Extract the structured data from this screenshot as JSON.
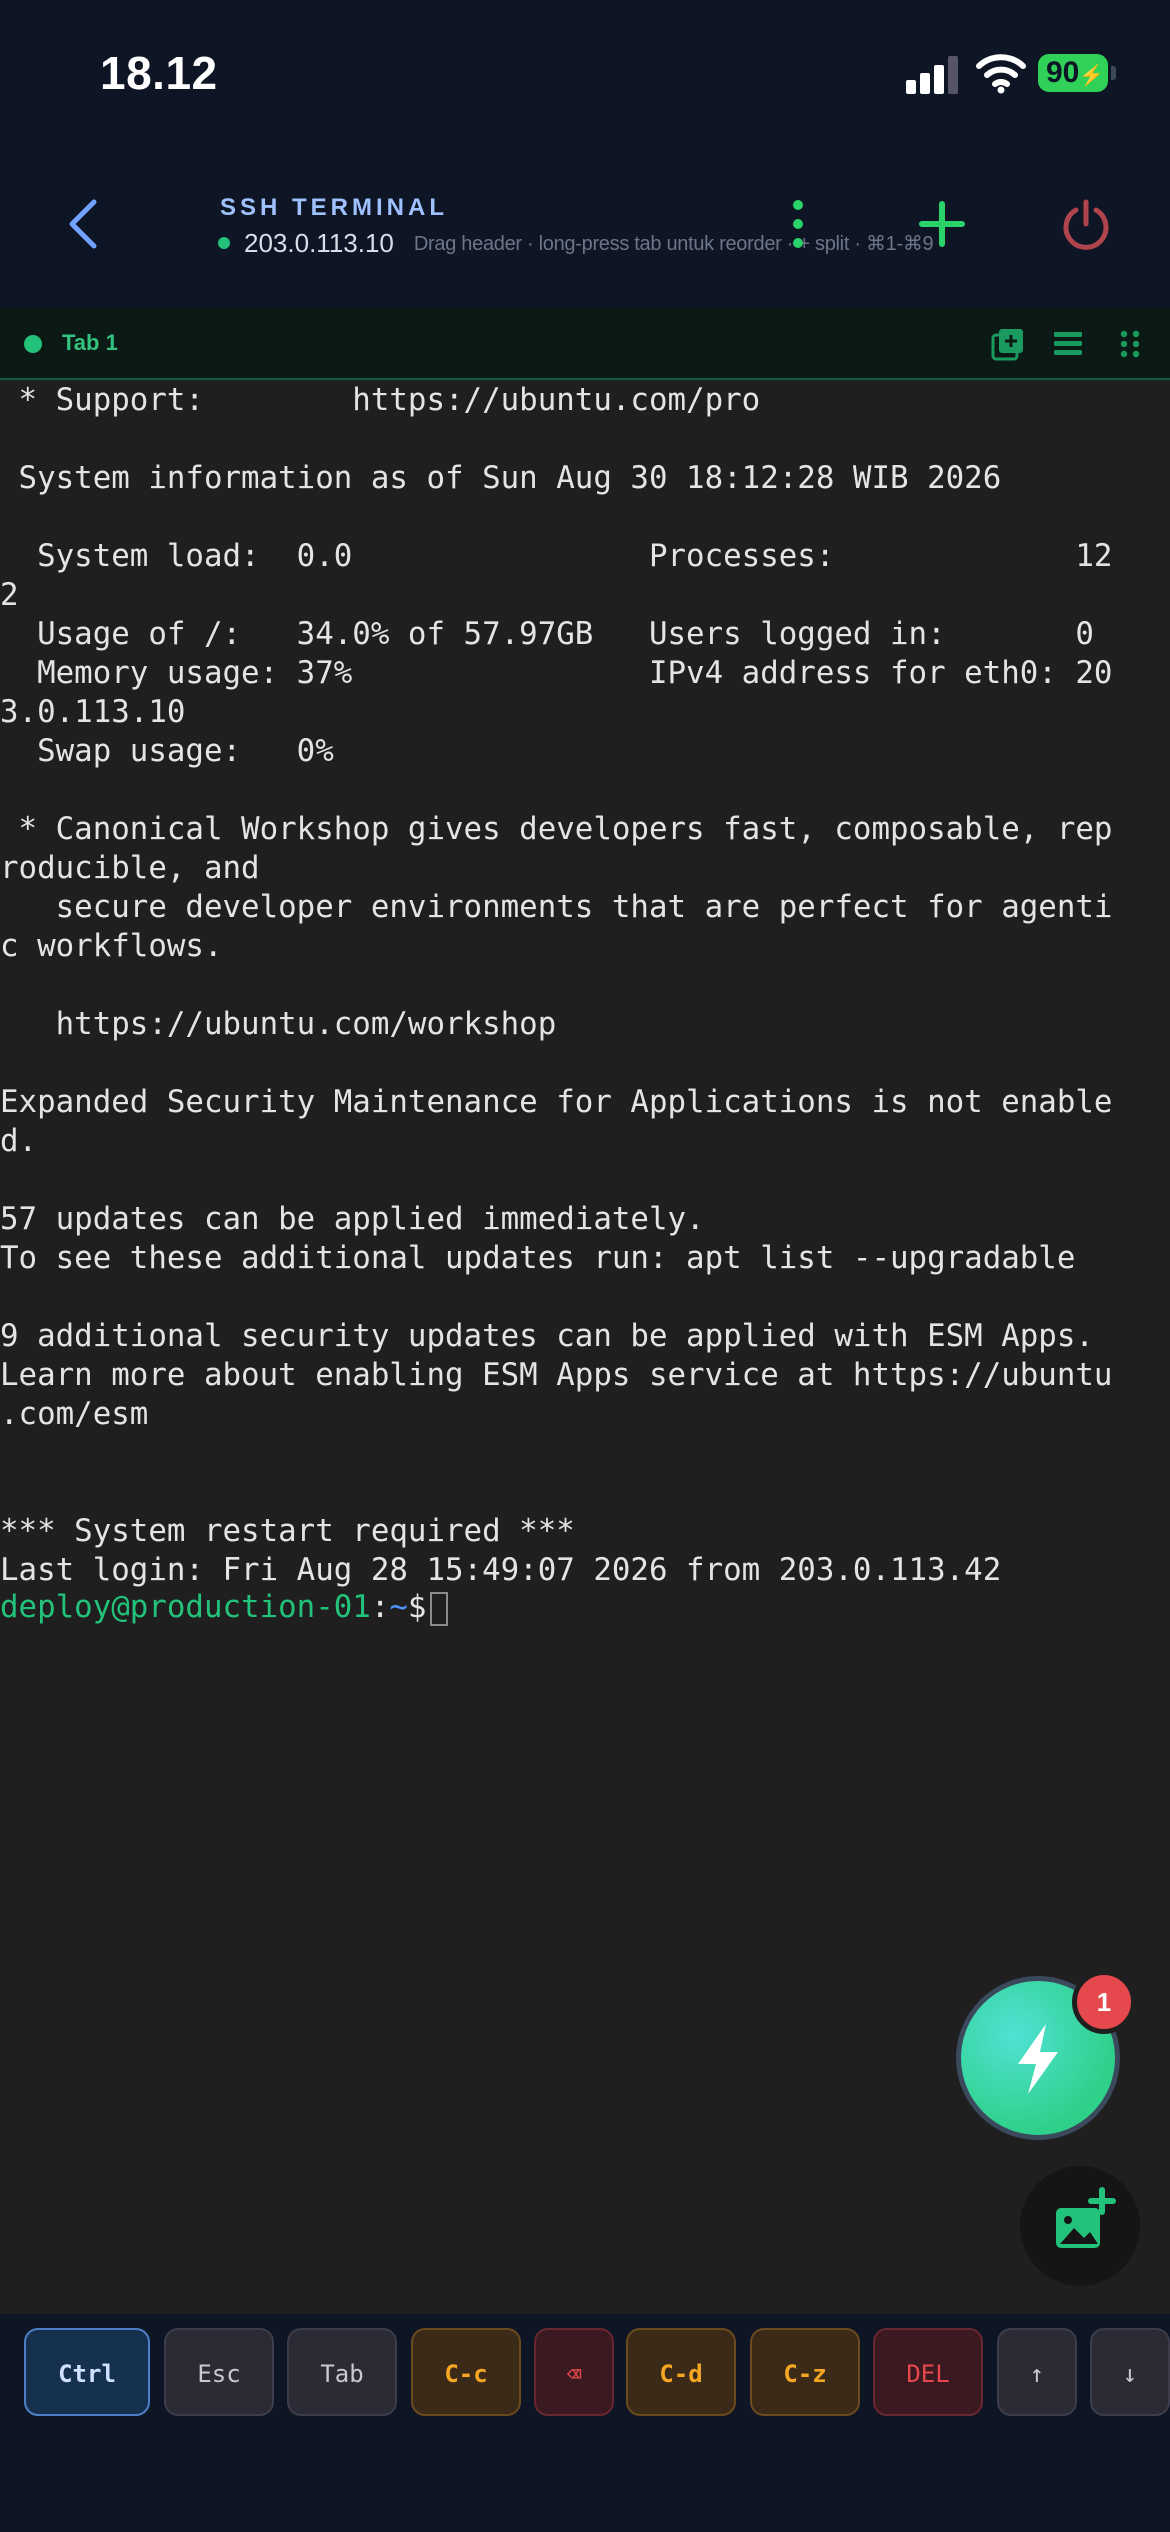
{
  "status_bar": {
    "time": "18.12",
    "battery": "90"
  },
  "header": {
    "title": "SSH TERMINAL",
    "host": "203.0.113.10",
    "hint": "Drag header · long-press tab untuk reorder · + split · ⌘1-⌘9"
  },
  "tabs": [
    {
      "label": "Tab 1"
    }
  ],
  "terminal": {
    "lines": [
      " * Support:        https://ubuntu.com/pro",
      "",
      " System information as of Sun Aug 30 18:12:28 WIB 2026",
      "",
      "  System load:  0.0                Processes:             12",
      "2",
      "  Usage of /:   34.0% of 57.97GB   Users logged in:       0",
      "  Memory usage: 37%                IPv4 address for eth0: 20",
      "3.0.113.10",
      "  Swap usage:   0%",
      "",
      " * Canonical Workshop gives developers fast, composable, rep",
      "roducible, and",
      "   secure developer environments that are perfect for agenti",
      "c workflows.",
      "",
      "   https://ubuntu.com/workshop",
      "",
      "Expanded Security Maintenance for Applications is not enable",
      "d.",
      "",
      "57 updates can be applied immediately.",
      "To see these additional updates run: apt list --upgradable",
      "",
      "9 additional security updates can be applied with ESM Apps.",
      "Learn more about enabling ESM Apps service at https://ubuntu",
      ".com/esm",
      "",
      "",
      "*** System restart required ***",
      "Last login: Fri Aug 28 15:49:07 2026 from 203.0.113.42"
    ],
    "prompt_user": "deploy@production-01",
    "prompt_sep": ":",
    "prompt_path": "~",
    "prompt_symbol": "$"
  },
  "fab": {
    "badge": "1"
  },
  "keys": [
    "Ctrl",
    "Esc",
    "Tab",
    "C-c",
    "⌫",
    "C-d",
    "C-z",
    "DEL",
    "↑",
    "↓"
  ],
  "colors": {
    "accent_green": "#22c27a",
    "header_bg": "#0e1524",
    "terminal_bg": "#1f1f1f",
    "title_blue": "#9fc2ff",
    "danger": "#e5484d",
    "warning": "#f5a623"
  }
}
